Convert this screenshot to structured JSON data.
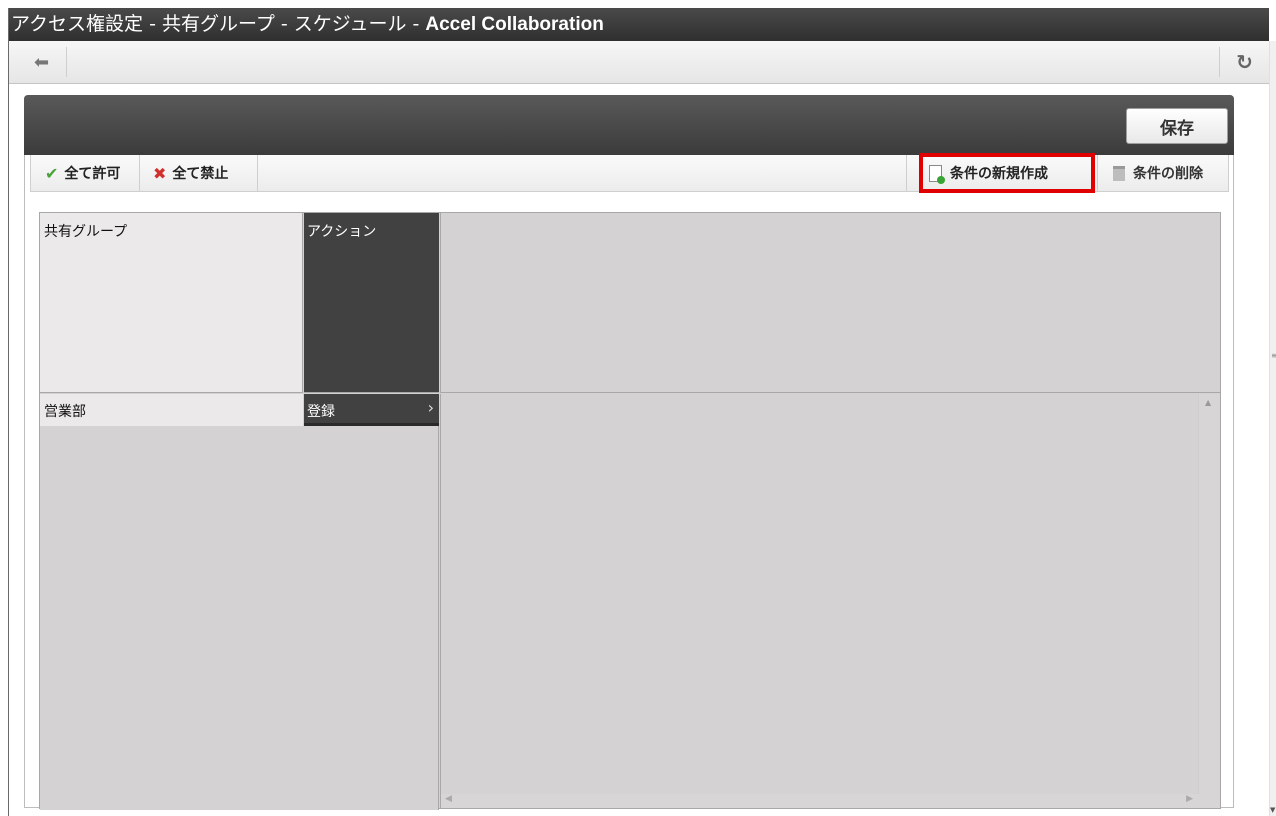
{
  "window": {
    "title_prefix": "アクセス権設定 - 共有グループ - スケジュール - ",
    "title_app": "Accel Collaboration"
  },
  "nav": {
    "back_icon": "arrow-left-icon",
    "reload_icon": "reload-icon"
  },
  "panel": {
    "save_label": "保存"
  },
  "toolbar": {
    "allow_all_label": "全て許可",
    "deny_all_label": "全て禁止",
    "new_condition_label": "条件の新規作成",
    "delete_condition_label": "条件の削除"
  },
  "grid": {
    "header_group": "共有グループ",
    "header_action": "アクション",
    "rows": [
      {
        "group": "営業部",
        "action": "登録"
      }
    ]
  },
  "colors": {
    "highlight": "#e00000",
    "header_dark": "#424142",
    "allow_icon": "#4aa33a",
    "deny_icon": "#d0312d"
  }
}
